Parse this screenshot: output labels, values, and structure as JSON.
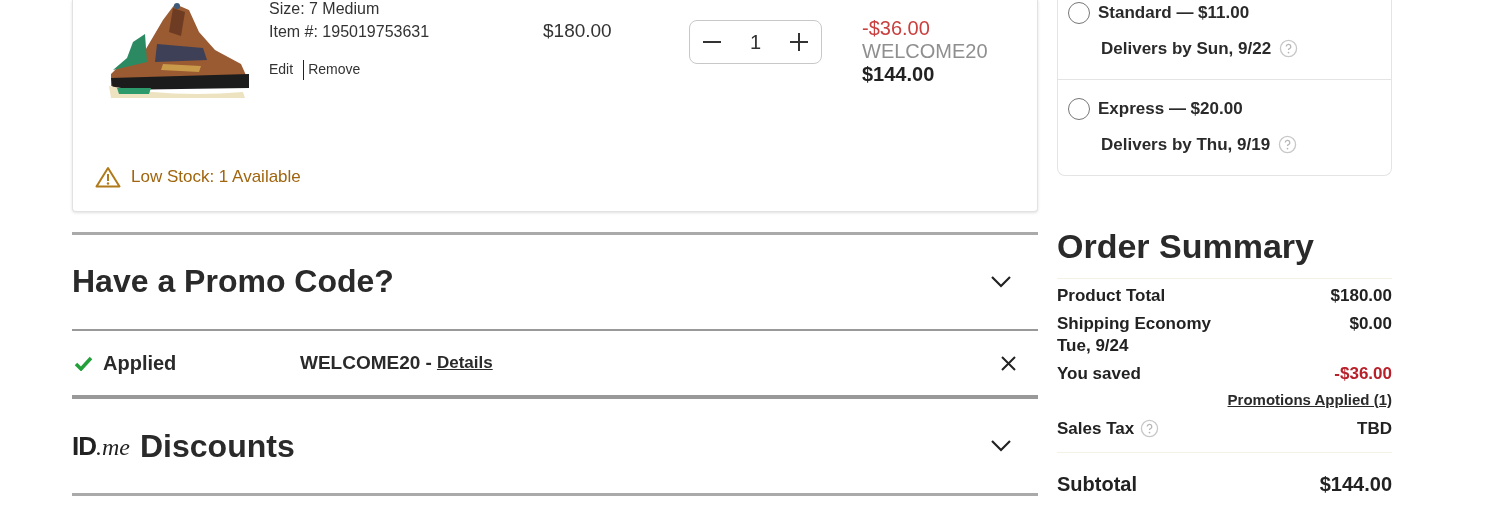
{
  "cart_item": {
    "size": "Size: 7 Medium",
    "item_number": "Item #: 195019753631",
    "actions": [
      "Edit",
      "Remove"
    ],
    "price": "$180.00",
    "quantity": "1",
    "discount": "-$36.00",
    "promo_code": "WELCOME20",
    "total": "$144.00",
    "stock_warning": "Low Stock: 1 Available"
  },
  "shipping_options": [
    {
      "label": "Standard — $11.00",
      "delivery": "Delivers by Sun, 9/22",
      "selected": false
    },
    {
      "label": "Express — $20.00",
      "delivery": "Delivers by Thu, 9/19",
      "selected": false
    }
  ],
  "promo_section": {
    "title": "Have a Promo Code?",
    "expanded": false,
    "applied_status": "Applied",
    "applied_code": "WELCOME20 -",
    "details_link": "Details"
  },
  "idme_section": {
    "logo_id": "ID",
    "logo_me": ".me",
    "title": "Discounts",
    "expanded": false
  },
  "order_summary": {
    "title": "Order Summary",
    "rows": [
      {
        "kind": "plain",
        "label": "Product Total",
        "value": "$180.00"
      },
      {
        "kind": "sub",
        "label": "Shipping Economy",
        "sublabel": "Tue, 9/24",
        "value": "$0.00"
      },
      {
        "kind": "saving",
        "label": "You saved",
        "value": "-$36.00"
      },
      {
        "kind": "link",
        "label": "Promotions Applied (1)"
      },
      {
        "kind": "help",
        "label": "Sales Tax",
        "value": "TBD"
      }
    ],
    "subtotal_label": "Subtotal",
    "subtotal_value": "$144.00"
  }
}
